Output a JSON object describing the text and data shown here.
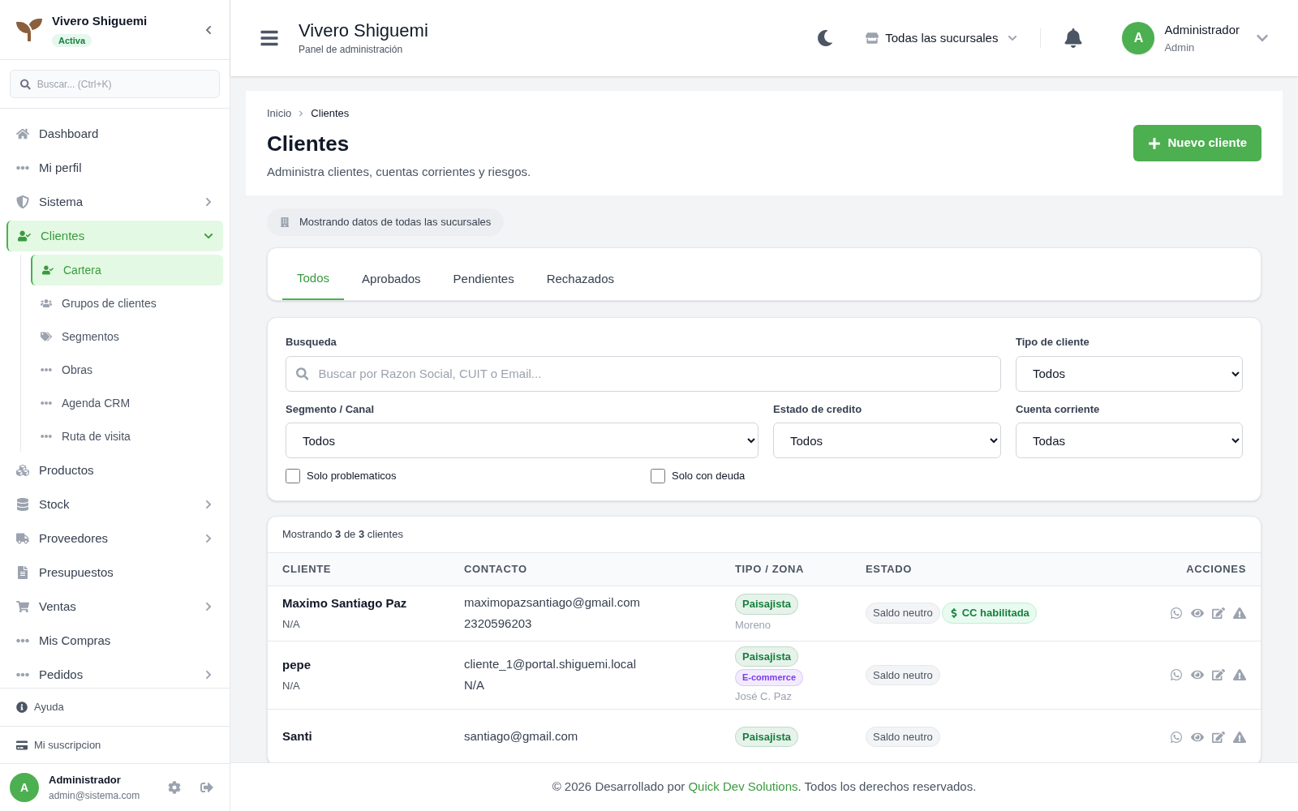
{
  "sidebar": {
    "brand": "Vivero Shiguemi",
    "status": "Activa",
    "search": {
      "placeholder": "Buscar... (Ctrl+K)"
    },
    "items": [
      {
        "label": "Dashboard",
        "kind": "link",
        "selected": false
      },
      {
        "label": "Mi perfil",
        "kind": "link",
        "selected": false
      },
      {
        "label": "Sistema",
        "kind": "group",
        "selected": false,
        "expanded": false
      },
      {
        "label": "Clientes",
        "kind": "group",
        "selected": true,
        "expanded": true,
        "children": [
          {
            "label": "Cartera",
            "selected": true
          },
          {
            "label": "Grupos de clientes",
            "selected": false
          },
          {
            "label": "Segmentos",
            "selected": false
          },
          {
            "label": "Obras",
            "selected": false
          },
          {
            "label": "Agenda CRM",
            "selected": false
          },
          {
            "label": "Ruta de visita",
            "selected": false
          }
        ]
      },
      {
        "label": "Productos",
        "kind": "link",
        "selected": false
      },
      {
        "label": "Stock",
        "kind": "group",
        "selected": false,
        "expanded": false
      },
      {
        "label": "Proveedores",
        "kind": "group",
        "selected": false,
        "expanded": false
      },
      {
        "label": "Presupuestos",
        "kind": "link",
        "selected": false
      },
      {
        "label": "Ventas",
        "kind": "group",
        "selected": false,
        "expanded": false
      },
      {
        "label": "Mis Compras",
        "kind": "link",
        "selected": false
      },
      {
        "label": "Pedidos",
        "kind": "group",
        "selected": false,
        "expanded": false
      }
    ],
    "help": "Ayuda",
    "subscription": "Mi suscripcion",
    "user": {
      "initial": "A",
      "name": "Administrador",
      "email": "admin@sistema.com"
    }
  },
  "header": {
    "title": "Vivero Shiguemi",
    "subtitle": "Panel de administración",
    "branch": "Todas las sucursales",
    "user": {
      "initial": "A",
      "name": "Administrador",
      "role": "Admin"
    }
  },
  "page": {
    "breadcrumb": [
      "Inicio",
      "Clientes"
    ],
    "title": "Clientes",
    "subtitle": "Administra clientes, cuentas corrientes y riesgos.",
    "new_button": "Nuevo cliente",
    "scope": "Mostrando datos de todas las sucursales"
  },
  "tabs": [
    {
      "label": "Todos",
      "selected": true
    },
    {
      "label": "Aprobados",
      "selected": false
    },
    {
      "label": "Pendientes",
      "selected": false
    },
    {
      "label": "Rechazados",
      "selected": false
    }
  ],
  "filters": {
    "search": {
      "label": "Busqueda",
      "placeholder": "Buscar por Razon Social, CUIT o Email..."
    },
    "type": {
      "label": "Tipo de cliente",
      "value": "Todos"
    },
    "segment": {
      "label": "Segmento / Canal",
      "value": "Todos"
    },
    "credit": {
      "label": "Estado de credito",
      "value": "Todos"
    },
    "account": {
      "label": "Cuenta corriente",
      "value": "Todas"
    },
    "checks": [
      {
        "label": "Solo problematicos",
        "checked": false
      },
      {
        "label": "Solo con deuda",
        "checked": false
      }
    ]
  },
  "table": {
    "summary": "Mostrando **3** de **3** clientes",
    "columns": [
      "CLIENTE",
      "CONTACTO",
      "TIPO / ZONA",
      "ESTADO",
      "ACCIONES"
    ],
    "rows": [
      {
        "name": "Maximo Santiago Paz",
        "sub": "N/A",
        "email": "maximopazsantiago@gmail.com",
        "phone": "2320596203",
        "tags": [
          {
            "label": "Paisajista",
            "color": "#15803d"
          }
        ],
        "zone": "Moreno",
        "status": [
          {
            "label": "Saldo neutro",
            "kind": "neutral"
          },
          {
            "label": "CC habilitada",
            "kind": "credit"
          }
        ]
      },
      {
        "name": "pepe",
        "sub": "N/A",
        "email": "cliente_1@portal.shiguemi.local",
        "phone": "N/A",
        "tags": [
          {
            "label": "Paisajista",
            "color": "#15803d"
          },
          {
            "label": "E-commerce",
            "color": "#7c3aed"
          }
        ],
        "zone": "José C. Paz",
        "status": [
          {
            "label": "Saldo neutro",
            "kind": "neutral"
          }
        ]
      },
      {
        "name": "Santi",
        "email": "santiago@gmail.com",
        "tags": [
          {
            "label": "Paisajista",
            "color": "#15803d"
          }
        ],
        "status": [
          {
            "label": "Saldo neutro",
            "kind": "neutral"
          }
        ]
      }
    ]
  },
  "footer": {
    "before": "© 2026 Desarrollado por",
    "link": "Quick Dev Solutions",
    "after": ". Todos los derechos reservados."
  }
}
